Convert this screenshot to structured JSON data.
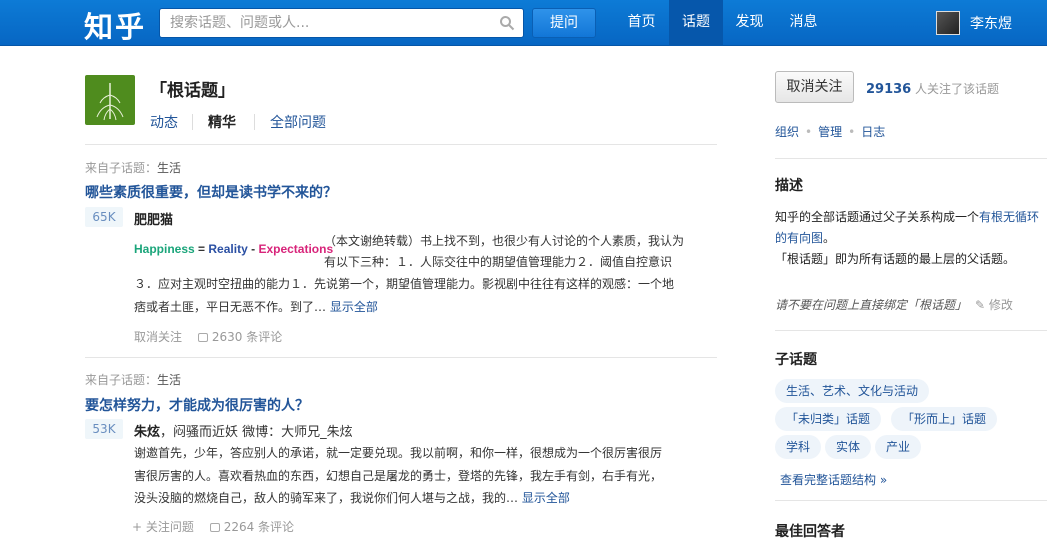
{
  "header": {
    "logo": "知乎",
    "search_placeholder": "搜索话题、问题或人...",
    "ask_label": "提问",
    "nav": [
      "首页",
      "话题",
      "发现",
      "消息"
    ],
    "user_name": "李东煜"
  },
  "topic": {
    "title": "「根话题」",
    "tabs": [
      "动态",
      "精华",
      "全部问题"
    ]
  },
  "feed": [
    {
      "from_label": "来自子话题：",
      "from_topic": "生活",
      "question": "哪些素质很重要，但却是读书学不来的？",
      "votes": "65K",
      "author": "肥肥猫",
      "author_bio": "",
      "image_words": [
        "Happiness",
        "=",
        "Reality",
        "-",
        "Expectations"
      ],
      "excerpt_lines": [
        "（本文谢绝转载）书上找不到，也很少有人讨论的个人素质，我认为",
        "有以下三种：１．人际交往中的期望值管理能力２．阈值自控意识",
        "３．应对主观时空扭曲的能力１．先说第一个，期望值管理能力。影视剧中往往有这样的观感：一个地",
        "痞或者土匪，平日无恶不作。到了…"
      ],
      "more": "显示全部",
      "follow": "取消关注",
      "comments": "2630 条评论"
    },
    {
      "from_label": "来自子话题：",
      "from_topic": "生活",
      "question": "要怎样努力，才能成为很厉害的人？",
      "votes": "53K",
      "author": "朱炫",
      "author_bio": "，闷骚而近妖 微博：大师兄_朱炫",
      "excerpt_lines": [
        "谢邀首先，少年，答应别人的承诺，就一定要兑现。我以前啊，和你一样，很想成为一个很厉害很厉",
        "害很厉害的人。喜欢看热血的东西，幻想自己是屠龙的勇士，登塔的先锋，我左手有剑，右手有光，",
        "没头没脑的燃烧自己，敌人的骑军来了，我说你们何人堪与之战，我的…"
      ],
      "more": "显示全部",
      "follow": "+ 关注问题",
      "comments": "2264 条评论"
    }
  ],
  "sidebar": {
    "unfollow_label": "取消关注",
    "followers_count": "29136",
    "followers_text": " 人关注了该话题",
    "links": [
      "组织",
      "管理",
      "日志"
    ],
    "desc_heading": "描述",
    "desc_part1": "知乎的全部话题通过父子关系构成一个",
    "desc_link": "有根无循环的有向图",
    "desc_part2": "。",
    "desc_line2": "「根话题」即为所有话题的最上层的父话题。",
    "note": "请不要在问题上直接绑定「根话题」",
    "edit_label": "修改",
    "subtopics_heading": "子话题",
    "subtopics": [
      "生活、艺术、文化与活动",
      "「未归类」话题",
      "「形而上」话题",
      "学科",
      "实体",
      "产业"
    ],
    "full_structure": "查看完整话题结构 »",
    "best_heading": "最佳回答者"
  },
  "colors": {
    "topbar": "#0a70cf",
    "link": "#225599",
    "vote_bg": "#eff6fa"
  }
}
